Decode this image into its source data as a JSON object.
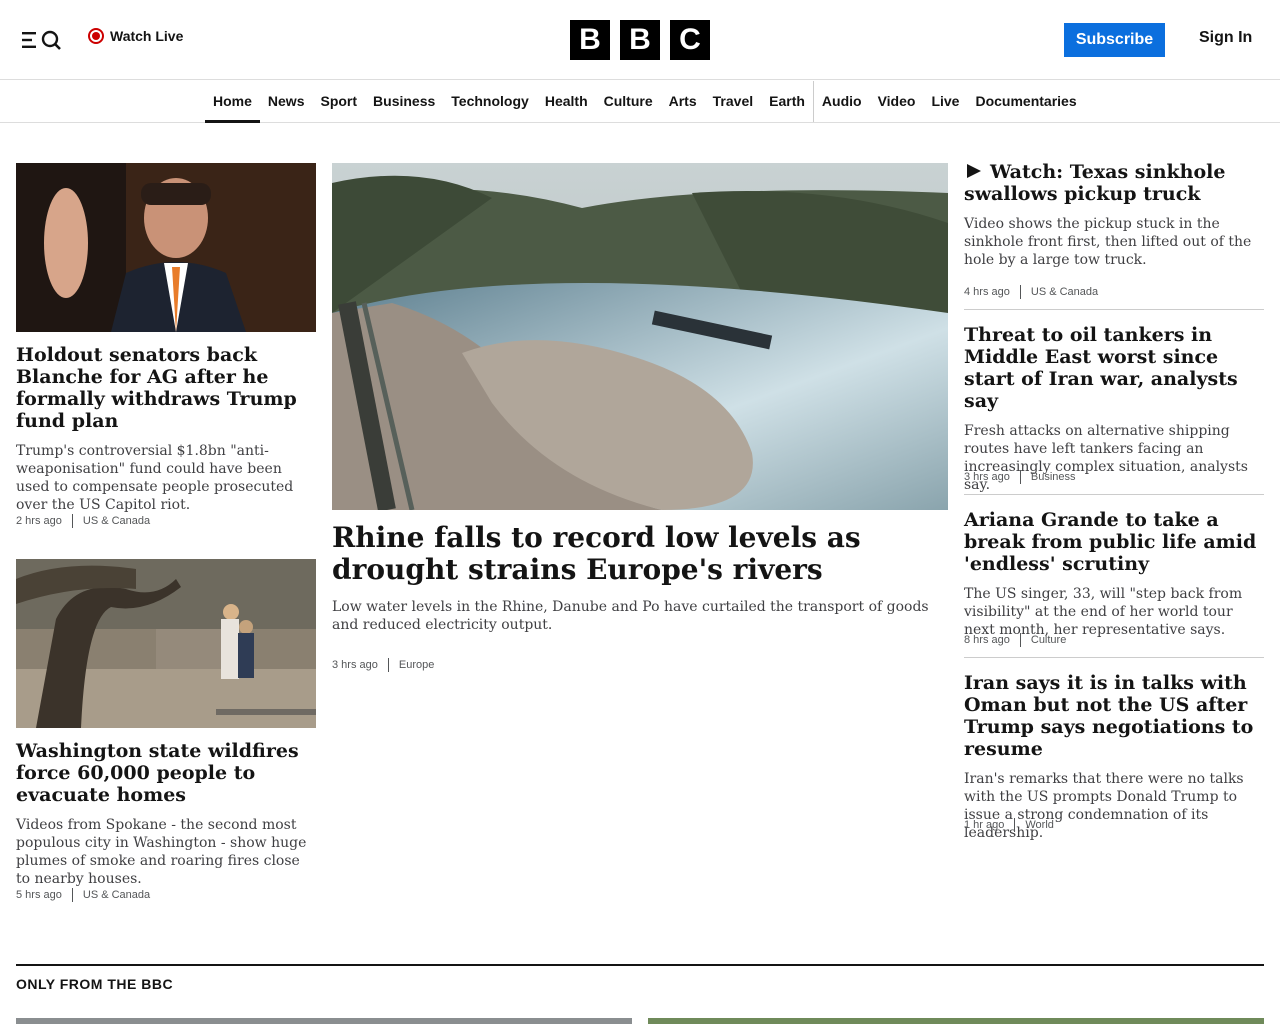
{
  "header": {
    "watch_live": "Watch Live",
    "logo_letters": [
      "B",
      "B",
      "C"
    ],
    "subscribe": "Subscribe",
    "sign_in": "Sign In"
  },
  "nav": {
    "items": [
      "Home",
      "News",
      "Sport",
      "Business",
      "Technology",
      "Health",
      "Culture",
      "Arts",
      "Travel",
      "Earth",
      "Audio",
      "Video",
      "Live",
      "Documentaries"
    ],
    "active": "Home"
  },
  "left_col": [
    {
      "headline": "Holdout senators back Blanche for AG after he formally withdraws Trump fund plan",
      "summary": "Trump's controversial $1.8bn \"anti-weaponisation\" fund could have been used to compensate people prosecuted over the US Capitol riot.",
      "time": "2 hrs ago",
      "tag": "US & Canada"
    },
    {
      "headline": "Washington state wildfires force 60,000 people to evacuate homes",
      "summary": "Videos from Spokane - the second most populous city in Washington - show huge plumes of smoke and roaring fires close to nearby houses.",
      "time": "5 hrs ago",
      "tag": "US & Canada"
    }
  ],
  "lead": {
    "headline": "Rhine falls to record low levels as drought strains Europe's rivers",
    "summary": "Low water levels in the Rhine, Danube and Po have curtailed the transport of goods and reduced electricity output.",
    "time": "3 hrs ago",
    "tag": "Europe"
  },
  "right_col": [
    {
      "headline": "Watch: Texas sinkhole swallows pickup truck",
      "summary": "Video shows the pickup stuck in the sinkhole front first, then lifted out of the hole by a large tow truck.",
      "time": "4 hrs ago",
      "tag": "US & Canada"
    },
    {
      "headline": "Threat to oil tankers in Middle East worst since start of Iran war, analysts say",
      "summary": "Fresh attacks on alternative shipping routes have left tankers facing an increasingly complex situation, analysts say.",
      "time": "3 hrs ago",
      "tag": "Business"
    },
    {
      "headline": "Ariana Grande to take a break from public life amid 'endless' scrutiny",
      "summary": "The US singer, 33, will \"step back from visibility\" at the end of her world tour next month, her representative says.",
      "time": "8 hrs ago",
      "tag": "Culture"
    },
    {
      "headline": "Iran says it is in talks with Oman but not the US after Trump says negotiations to resume",
      "summary": "Iran's remarks that there were no talks with the US prompts Donald Trump to issue a strong condemnation of its leadership.",
      "time": "1 hr ago",
      "tag": "World"
    }
  ],
  "section": {
    "title": "ONLY FROM THE BBC"
  }
}
